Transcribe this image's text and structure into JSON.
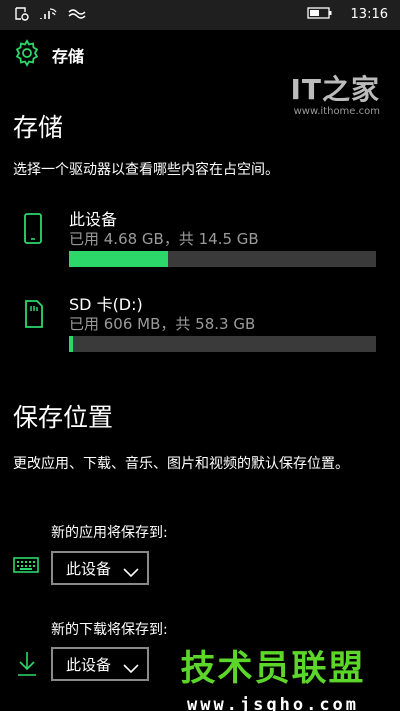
{
  "status_bar": {
    "time": "13:16",
    "icons": [
      "notification-icon",
      "wifi-icon",
      "network-icon",
      "battery-icon"
    ]
  },
  "header": {
    "title": "存储",
    "icon": "gear-icon"
  },
  "watermark_top": {
    "logo": "IT之家",
    "url": "www.ithome.com"
  },
  "storage": {
    "title": "存储",
    "description": "选择一个驱动器以查看哪些内容在占空间。",
    "drives": [
      {
        "name": "此设备",
        "usage": "已用 4.68 GB，共 14.5 GB",
        "used_fraction": 0.3228,
        "icon": "phone-icon"
      },
      {
        "name": "SD 卡(D:)",
        "usage": "已用 606 MB，共 58.3 GB",
        "used_fraction": 0.0102,
        "icon": "sd-card-icon"
      }
    ]
  },
  "save_locations": {
    "title": "保存位置",
    "description": "更改应用、下载、音乐、图片和视频的默认保存位置。",
    "items": [
      {
        "label": "新的应用将保存到:",
        "value": "此设备",
        "icon": "keyboard-icon"
      },
      {
        "label": "新的下载将保存到:",
        "value": "此设备",
        "icon": "download-icon"
      }
    ]
  },
  "watermark_bottom": {
    "text": "技术员联盟",
    "url": "www.jsgho.com"
  },
  "colors": {
    "accent": "#2dd86a",
    "background": "#000000",
    "bar_track": "#3a3a3a",
    "secondary_text": "#9a9a9a",
    "watermark_green": "#5cd62a"
  }
}
